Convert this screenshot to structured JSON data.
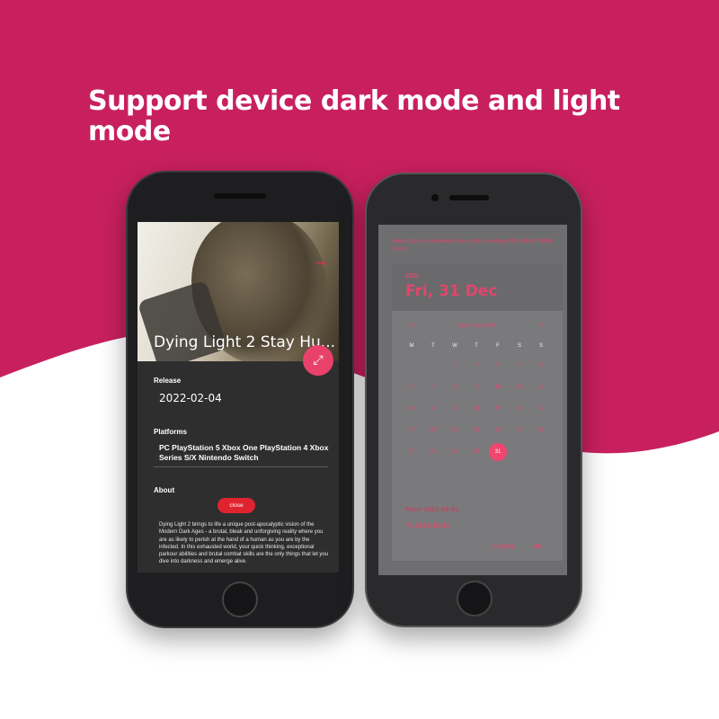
{
  "promo": {
    "headline": "Support device dark mode and light mode",
    "colors": {
      "brand": "#c8205e",
      "accent": "#e8426b",
      "close_button": "#e0242f"
    }
  },
  "left_phone": {
    "hero": {
      "title": "Dying Light 2 Stay Hu...",
      "arrow_icon": "arrow-right-icon",
      "fab_icon": "collapse-arrows-icon"
    },
    "release": {
      "label": "Release",
      "value": "2022-02-04"
    },
    "platforms": {
      "label": "Platforms",
      "value": "PC  PlayStation 5  Xbox One  PlayStation 4  Xbox Series S/X  Nintendo Switch"
    },
    "about": {
      "label": "About",
      "close_label": "close",
      "text": "Dying Light 2 brings to life a unique post-apocalyptic vision of the Modern Dark Ages - a brutal, bleak and unforgiving reality where you are as likely to perish at the hand of a human as you are by the infected. In this exhausted world, your quick thinking, exceptional parkour abilities and brutal combat skills are the only things that let you dive into darkness and emerge alive."
    }
  },
  "right_phone": {
    "helper_text": "select dates in between form start to end eg 2019-09-01:2019-09-30",
    "year": "2021",
    "selected_date": "Fri, 31 Dec",
    "month": "December 2021",
    "weekdays": [
      "M",
      "T",
      "W",
      "T",
      "F",
      "S",
      "S"
    ],
    "days": [
      "1",
      "2",
      "3",
      "4",
      "5",
      "6",
      "7",
      "8",
      "9",
      "10",
      "11",
      "12",
      "13",
      "14",
      "15",
      "16",
      "17",
      "18",
      "19",
      "20",
      "21",
      "22",
      "23",
      "24",
      "25",
      "26",
      "27",
      "28",
      "29",
      "30",
      "31"
    ],
    "selected_day": "31",
    "first_weekday_index": 2,
    "from": "From  2021-09-01",
    "to": "To  2021-12-31",
    "cancel_label": "CANCEL",
    "ok_label": "OK"
  }
}
